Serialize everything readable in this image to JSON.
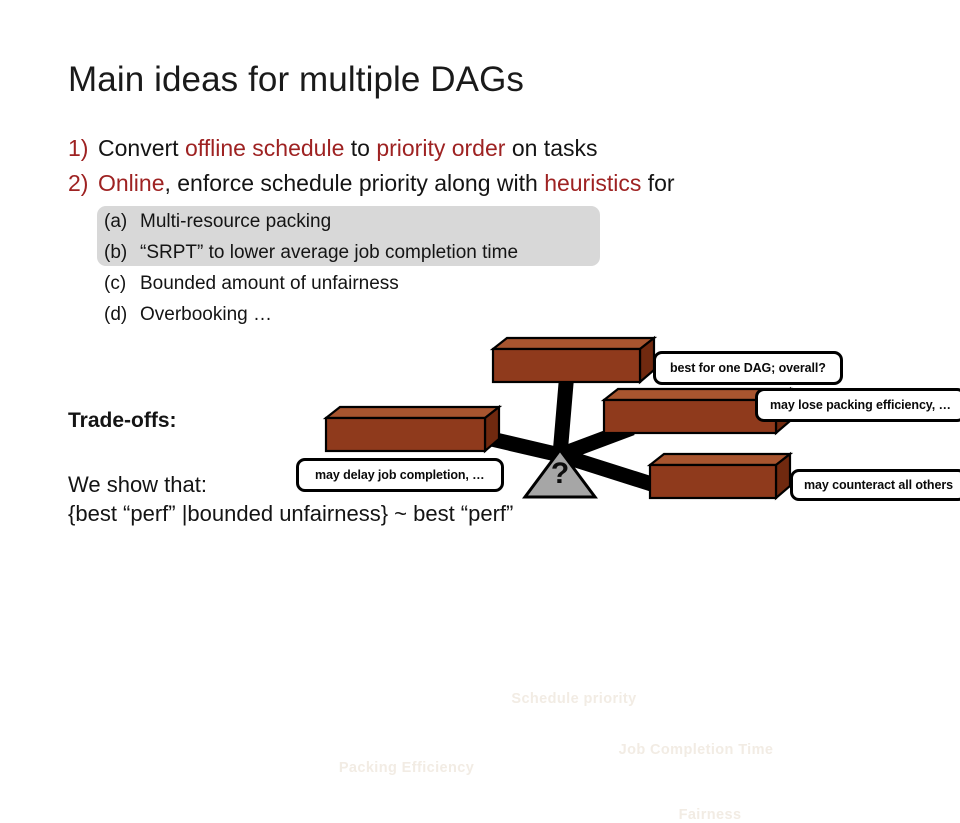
{
  "slide": {
    "title": "Main ideas for multiple DAGs",
    "background_color": "#ffffff",
    "accent_red": "#9e2222",
    "box_fill": "#8f3a1c",
    "box_top_fill": "#a8552f",
    "highlight_fill": "#d8d8d8",
    "triangle_fill": "#a6a6a6"
  },
  "bullets": [
    {
      "number": "1)",
      "parts": [
        {
          "text": "Convert ",
          "color": "black"
        },
        {
          "text": "offline schedule",
          "color": "red"
        },
        {
          "text": " to ",
          "color": "black"
        },
        {
          "text": "priority order",
          "color": "red"
        },
        {
          "text": " on tasks",
          "color": "black"
        }
      ],
      "plain": "1)  Convert offline schedule to priority order on tasks"
    },
    {
      "number": "2)",
      "parts": [
        {
          "text": "Online",
          "color": "red"
        },
        {
          "text": ", enforce schedule priority along with ",
          "color": "black"
        },
        {
          "text": "heuristics",
          "color": "red"
        },
        {
          "text": " for",
          "color": "black"
        }
      ],
      "plain": "2)  Online, enforce schedule priority along with heuristics for"
    }
  ],
  "sub_items": [
    {
      "label": "(a)",
      "text": "Multi-resource packing",
      "highlighted": true
    },
    {
      "label": "(b)",
      "text": "“SRPT” to lower average job completion time",
      "highlighted": true
    },
    {
      "label": "(c)",
      "text": "Bounded amount of unfairness",
      "highlighted": false
    },
    {
      "label": "(d)",
      "text": "Overbooking …",
      "highlighted": false
    }
  ],
  "left_labels": {
    "tradeoffs": "Trade-offs:",
    "we_show_line1": "We show that:",
    "we_show_line2": "{best “perf” |bounded unfairness} ~ best “perf”"
  },
  "diagram": {
    "hub_marker": "?",
    "boxes": [
      {
        "id": "schedule-priority",
        "label": "Schedule priority"
      },
      {
        "id": "job-completion-time",
        "label": "Job Completion Time"
      },
      {
        "id": "packing-efficiency",
        "label": "Packing Efficiency"
      },
      {
        "id": "fairness",
        "label": "Fairness"
      }
    ],
    "callouts": [
      {
        "id": "callout-schedule-priority",
        "text": "best for one DAG; overall?"
      },
      {
        "id": "callout-job-completion-time",
        "text": "may lose packing efficiency, …"
      },
      {
        "id": "callout-packing-efficiency",
        "text": "may delay job completion, …"
      },
      {
        "id": "callout-fairness",
        "text": "may counteract all others"
      }
    ]
  }
}
